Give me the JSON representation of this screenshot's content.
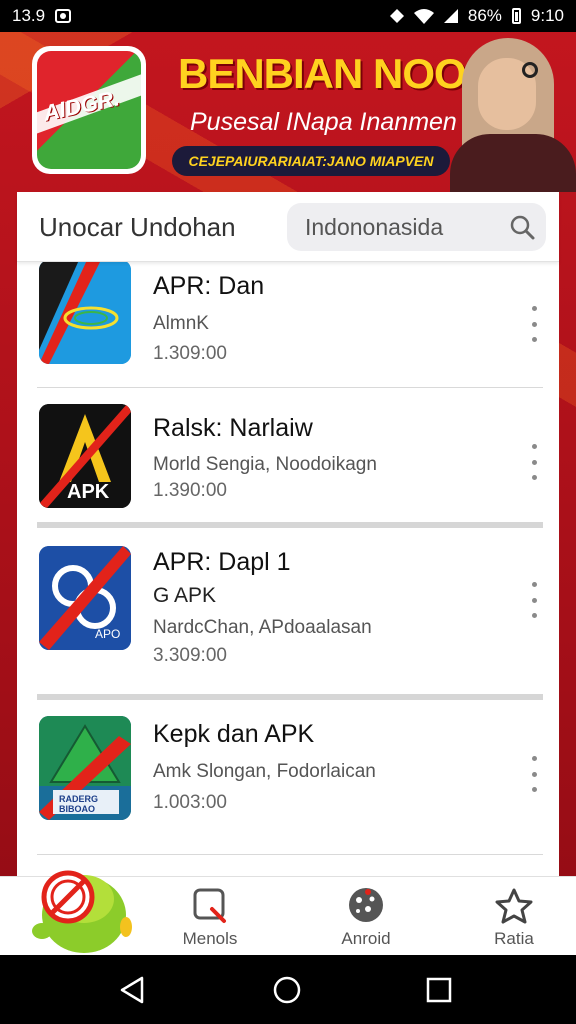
{
  "status_bar": {
    "time_left": "13.9",
    "battery_pct": "86%",
    "clock": "9:10"
  },
  "banner": {
    "logo_text": "AIDGR.",
    "logo_small": "",
    "title": "BENBIAN NOOAI",
    "subtitle": "Pusesal INapa Inanmen",
    "strip": "CEJEPAIURARIAIAT:JANO MIAPVEN"
  },
  "header": {
    "title": "Unocar Undohan",
    "search_value": "Indononasida"
  },
  "apps": [
    {
      "name": "APR: Dan",
      "sub": "AlmnK",
      "count": "1.309:00"
    },
    {
      "name": "Ralsk: Narlaiw",
      "sub": "Morld Sengia, Noodoikagn",
      "count": "1.390:00",
      "icon_label": "APK"
    },
    {
      "name": "APR: Dapl 1",
      "line2": "G APK",
      "sub": "NardcChan, APdoaalasan",
      "count": "3.309:00",
      "icon_label": "APO"
    },
    {
      "name": "Kepk dan APK",
      "sub": "Amk Slongan, Fodorlaican",
      "count": "1.003:00",
      "icon_label": "RADERG BIBOAO"
    }
  ],
  "bottom_nav": [
    {
      "label": "Menols",
      "icon": "search-icon"
    },
    {
      "label": "Anroid",
      "icon": "android-icon"
    },
    {
      "label": "Ratia",
      "icon": "star-icon"
    }
  ],
  "colors": {
    "brand_red": "#c4161f",
    "accent_yellow": "#ffd21f",
    "card_bg": "#ffffff"
  }
}
